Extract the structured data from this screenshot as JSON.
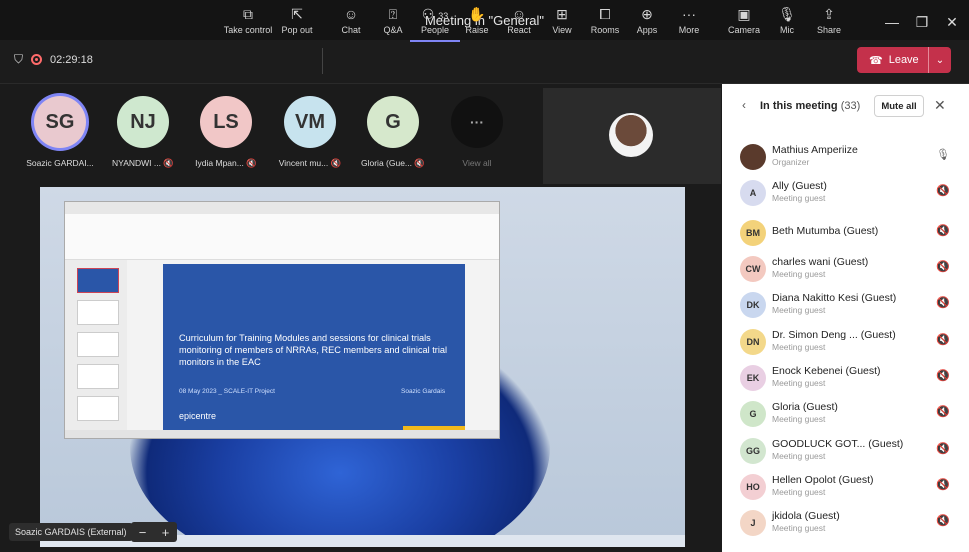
{
  "window": {
    "title": "Meeting in \"General\"",
    "controls": [
      "—",
      "❐",
      "✕"
    ]
  },
  "meeting": {
    "timer": "02:29:18"
  },
  "toolbar": {
    "buttons": [
      {
        "label": "Take control",
        "icon": "take-control-icon"
      },
      {
        "label": "Pop out",
        "icon": "pop-out-icon"
      },
      {
        "label": "Chat",
        "icon": "chat-icon"
      },
      {
        "label": "Q&A",
        "icon": "qa-icon"
      },
      {
        "label": "People",
        "icon": "people-icon",
        "badge": "33"
      },
      {
        "label": "Raise",
        "icon": "raise-hand-icon"
      },
      {
        "label": "React",
        "icon": "react-icon"
      },
      {
        "label": "View",
        "icon": "view-icon"
      },
      {
        "label": "Rooms",
        "icon": "rooms-icon"
      },
      {
        "label": "Apps",
        "icon": "apps-icon"
      },
      {
        "label": "More",
        "icon": "more-icon"
      },
      {
        "label": "Camera",
        "icon": "camera-off-icon"
      },
      {
        "label": "Mic",
        "icon": "mic-icon"
      },
      {
        "label": "Share",
        "icon": "share-icon"
      }
    ],
    "leave_label": "Leave",
    "accent": "#c4314b"
  },
  "gallery": {
    "participants": [
      {
        "initials": "SG",
        "name": "Soazic GARDAI...",
        "color": "#e9c9cf"
      },
      {
        "initials": "NJ",
        "name": "NYANDWI ...",
        "color": "#cfe8cf"
      },
      {
        "initials": "LS",
        "name": "Iydia Mpan...",
        "color": "#f1c7c7"
      },
      {
        "initials": "VM",
        "name": "Vincent mu...",
        "color": "#c7e3ee"
      },
      {
        "initials": "G",
        "name": "Gloria (Gue...",
        "color": "#d6e8cc"
      }
    ],
    "view_all_label": "View all",
    "view_all_glyph": "···"
  },
  "share": {
    "slide_title": "Curriculum for Training Modules and sessions for clinical trials monitoring of members of NRRAs, REC members and clinical trial monitors in the EAC",
    "slide_date": "08 May 2023 _ SCALE-IT Project",
    "slide_author": "Soazic Gardais",
    "slide_logo": "epicentre",
    "presenter_badge": "Soazic GARDAIS (External)",
    "zoom_out": "−",
    "zoom_in": "+"
  },
  "panel": {
    "title": "In this meeting",
    "count": "(33)",
    "mute_all": "Mute all",
    "people": [
      {
        "initials": "",
        "name": "Mathius Amperiize",
        "role": "Organizer",
        "color": "#5a3a2c",
        "mic": "on"
      },
      {
        "initials": "A",
        "name": "Ally (Guest)",
        "role": "Meeting guest",
        "color": "#d7dbef",
        "mic": "off"
      },
      {
        "initials": "BM",
        "name": "Beth Mutumba (Guest)",
        "role": "",
        "color": "#f3d27a",
        "mic": "off"
      },
      {
        "initials": "CW",
        "name": "charles wani (Guest)",
        "role": "Meeting guest",
        "color": "#f3c9c0",
        "mic": "off"
      },
      {
        "initials": "DK",
        "name": "Diana Nakitto Kesi (Guest)",
        "role": "Meeting guest",
        "color": "#c9d7ef",
        "mic": "off"
      },
      {
        "initials": "DN",
        "name": "Dr. Simon Deng ... (Guest)",
        "role": "Meeting guest",
        "color": "#f3d88a",
        "mic": "off"
      },
      {
        "initials": "EK",
        "name": "Enock Kebenei (Guest)",
        "role": "Meeting guest",
        "color": "#e9cfe3",
        "mic": "off"
      },
      {
        "initials": "G",
        "name": "Gloria (Guest)",
        "role": "Meeting guest",
        "color": "#cfe6c9",
        "mic": "off"
      },
      {
        "initials": "GG",
        "name": "GOODLUCK GOT... (Guest)",
        "role": "Meeting guest",
        "color": "#d2e6cf",
        "mic": "off"
      },
      {
        "initials": "HO",
        "name": "Hellen Opolot (Guest)",
        "role": "Meeting guest",
        "color": "#f3cfd3",
        "mic": "off"
      },
      {
        "initials": "J",
        "name": "jkidola (Guest)",
        "role": "Meeting guest",
        "color": "#f3d6c6",
        "mic": "off"
      }
    ]
  }
}
